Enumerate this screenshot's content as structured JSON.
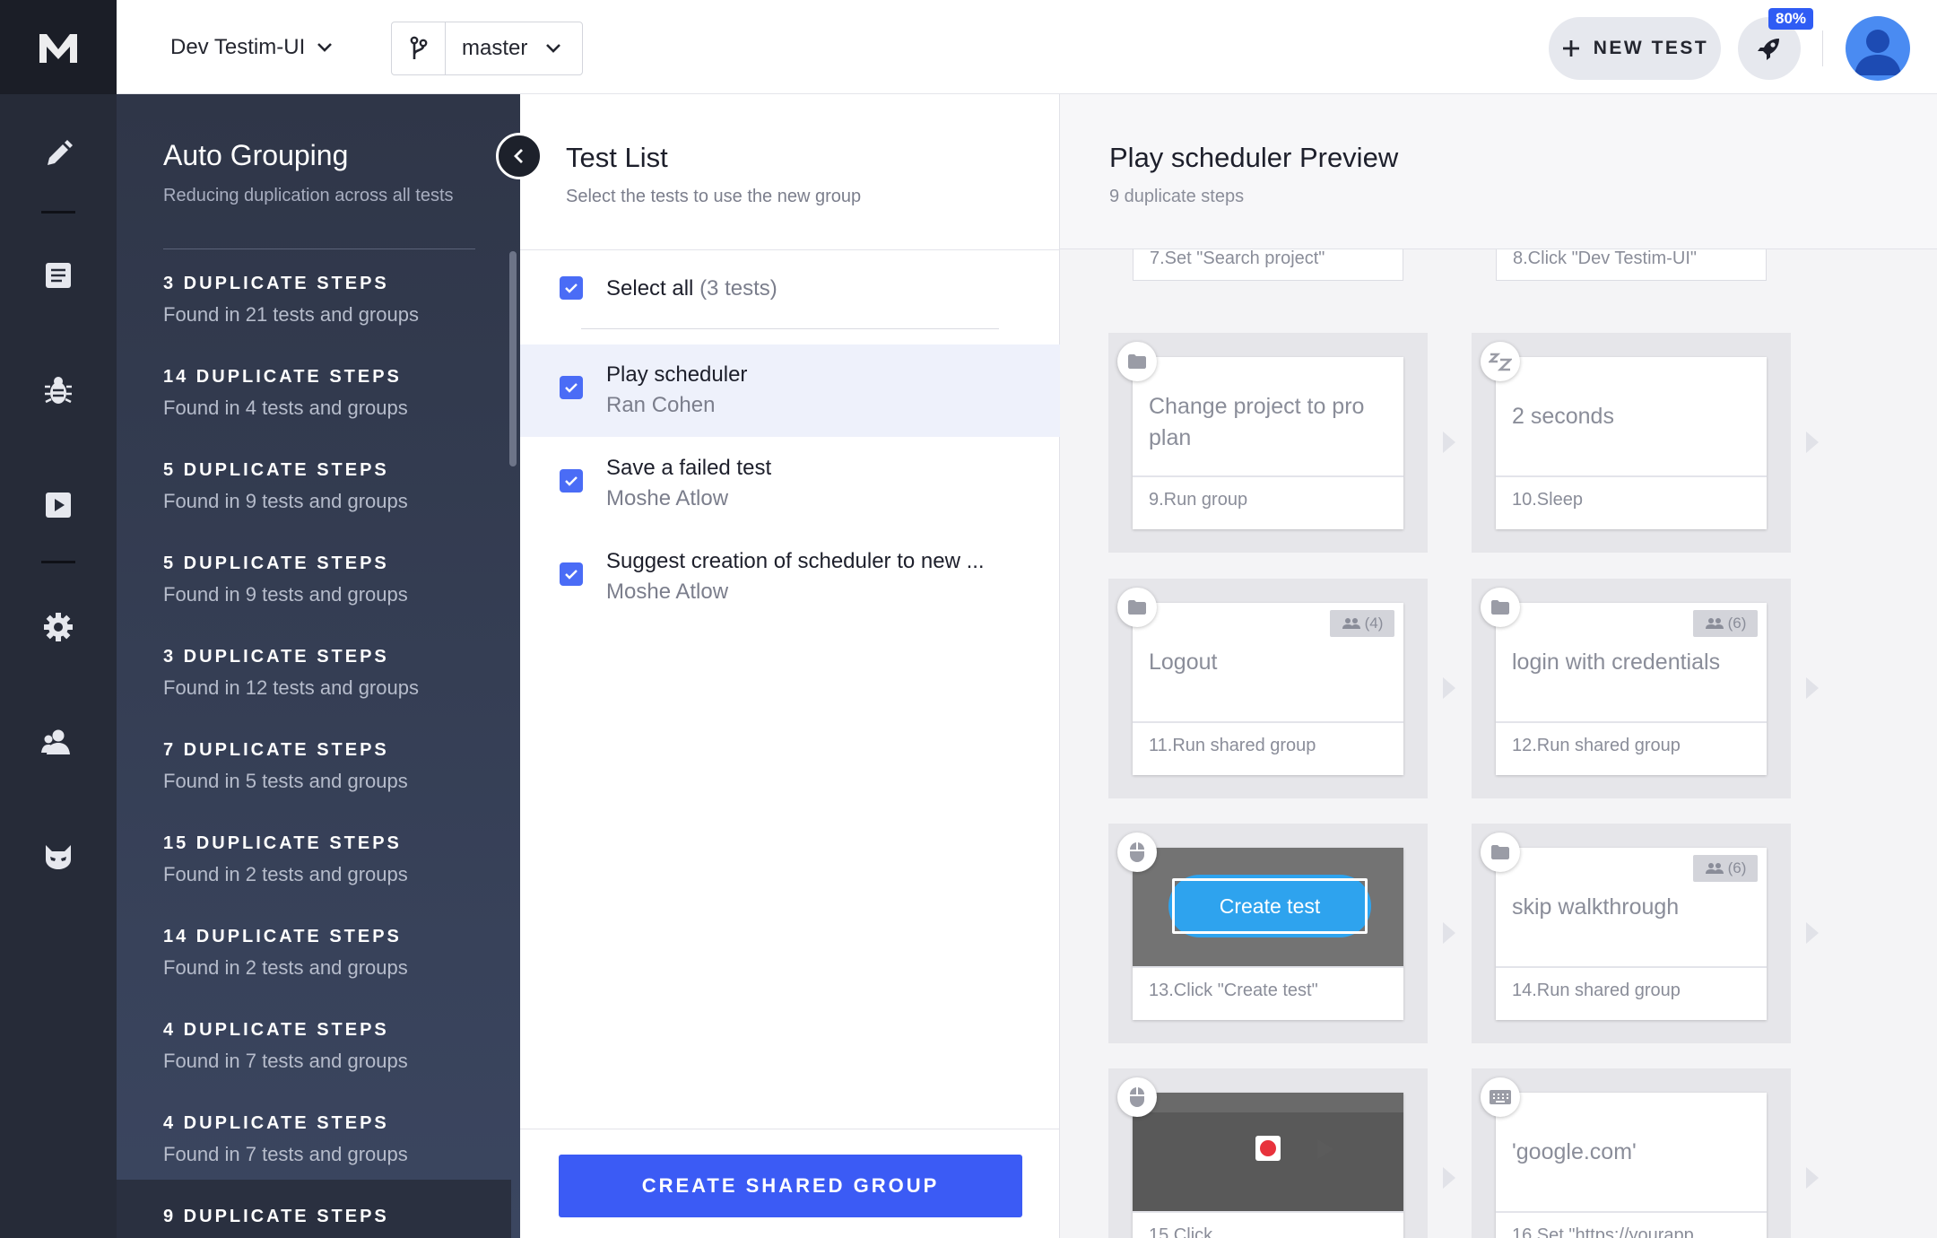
{
  "topbar": {
    "project_name": "Dev Testim-UI",
    "branch_name": "master",
    "new_test_label": "NEW TEST",
    "progress_badge": "80%"
  },
  "colors": {
    "accent": "#3b5bf5",
    "rail_bg": "#262b38",
    "panel_bg": "#2f3648",
    "checkbox": "#4a6cf6",
    "badge": "#2f5cf4"
  },
  "rail": {
    "icons": [
      "logo-icon",
      "edit-icon",
      "list-icon",
      "bug-icon",
      "play-icon",
      "gear-icon",
      "users-icon",
      "mask-icon"
    ]
  },
  "grouping": {
    "title": "Auto Grouping",
    "subtitle": "Reducing duplication across all tests",
    "items": [
      {
        "title": "3 DUPLICATE STEPS",
        "found": "Found in 21 tests and groups"
      },
      {
        "title": "14 DUPLICATE STEPS",
        "found": "Found in 4 tests and groups"
      },
      {
        "title": "5 DUPLICATE STEPS",
        "found": "Found in 9 tests and groups"
      },
      {
        "title": "5 DUPLICATE STEPS",
        "found": "Found in 9 tests and groups"
      },
      {
        "title": "3 DUPLICATE STEPS",
        "found": "Found in 12 tests and groups"
      },
      {
        "title": "7 DUPLICATE STEPS",
        "found": "Found in 5 tests and groups"
      },
      {
        "title": "15 DUPLICATE STEPS",
        "found": "Found in 2 tests and groups"
      },
      {
        "title": "14 DUPLICATE STEPS",
        "found": "Found in 2 tests and groups"
      },
      {
        "title": "4 DUPLICATE STEPS",
        "found": "Found in 7 tests and groups"
      },
      {
        "title": "4 DUPLICATE STEPS",
        "found": "Found in 7 tests and groups"
      },
      {
        "title": "9 DUPLICATE STEPS",
        "found": ""
      }
    ]
  },
  "test_list": {
    "title": "Test List",
    "subtitle": "Select the tests to use the new group",
    "select_all_label": "Select all",
    "select_all_count": "(3 tests)",
    "tests": [
      {
        "name": "Play scheduler",
        "owner": "Ran Cohen"
      },
      {
        "name": "Save a failed test",
        "owner": "Moshe Atlow"
      },
      {
        "name": "Suggest creation of scheduler to new ...",
        "owner": "Moshe Atlow"
      }
    ],
    "create_button": "CREATE SHARED GROUP"
  },
  "preview": {
    "title": "Play scheduler Preview",
    "subtitle": "9 duplicate steps",
    "stub_left": "7.Set \"Search project\"",
    "stub_right": "8.Click \"Dev Testim-UI\"",
    "steps": [
      {
        "text": "Change project to pro plan",
        "label": "9.Run group",
        "icon": "folder-icon"
      },
      {
        "text": "2 seconds",
        "label": "10.Sleep",
        "icon": "sleep-icon"
      },
      {
        "text": "Logout",
        "label": "11.Run shared group",
        "icon": "folder-icon",
        "shared": "(4)"
      },
      {
        "text": "login with credentials",
        "label": "12.Run shared group",
        "icon": "folder-icon",
        "shared": "(6)"
      },
      {
        "image_text": "Create test",
        "label": "13.Click \"Create test\"",
        "icon": "mouse-icon"
      },
      {
        "text": "skip walkthrough",
        "label": "14.Run shared group",
        "icon": "folder-icon",
        "shared": "(6)"
      },
      {
        "label": "15.Click",
        "icon": "mouse-icon"
      },
      {
        "text": "'google.com'",
        "label": "16.Set \"https://yourapp",
        "icon": "keyboard-icon"
      }
    ]
  }
}
